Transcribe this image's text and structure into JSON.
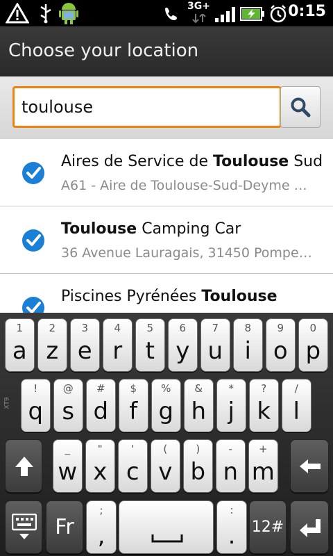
{
  "status_bar": {
    "network": "3G+",
    "time": "0:15",
    "icons": [
      "warning-icon",
      "usb-icon",
      "android-icon",
      "phone-mute-icon",
      "network-3g-icon",
      "signal-icon",
      "battery-charging-icon",
      "alarm-icon"
    ]
  },
  "title": "Choose your location",
  "search": {
    "value": "toulouse",
    "button_icon": "search-icon"
  },
  "results": [
    {
      "name_pre": "Aires de Service de ",
      "name_bold": "Toulouse",
      "name_post": " Sud",
      "address": "A61 - Aire de Toulouse-Sud-Deyme S..."
    },
    {
      "name_pre": "",
      "name_bold": "Toulouse",
      "name_post": " Camping Car",
      "address": "36 Avenue Lauragais, 31450 Pomper..."
    },
    {
      "name_pre": "Piscines Pyrénées ",
      "name_bold": "Toulouse",
      "name_post": "",
      "address": ""
    }
  ],
  "keyboard": {
    "row1": [
      {
        "hint": "1",
        "main": "a"
      },
      {
        "hint": "2",
        "main": "z"
      },
      {
        "hint": "3",
        "main": "e"
      },
      {
        "hint": "4",
        "main": "r"
      },
      {
        "hint": "5",
        "main": "t"
      },
      {
        "hint": "6",
        "main": "y"
      },
      {
        "hint": "7",
        "main": "u"
      },
      {
        "hint": "8",
        "main": "i"
      },
      {
        "hint": "9",
        "main": "o"
      },
      {
        "hint": "0",
        "main": "p"
      }
    ],
    "row2": [
      {
        "hint": "!",
        "main": "q"
      },
      {
        "hint": "@",
        "main": "s"
      },
      {
        "hint": "#",
        "main": "d"
      },
      {
        "hint": "$",
        "main": "f"
      },
      {
        "hint": "%",
        "main": "g"
      },
      {
        "hint": "&",
        "main": "h"
      },
      {
        "hint": "*",
        "main": "j"
      },
      {
        "hint": "?",
        "main": "k"
      },
      {
        "hint": "/",
        "main": "l"
      }
    ],
    "row3": [
      {
        "hint": "_",
        "main": "w"
      },
      {
        "hint": "\"",
        "main": "x"
      },
      {
        "hint": "'",
        "main": "c"
      },
      {
        "hint": "(",
        "main": "v"
      },
      {
        "hint": ")",
        "main": "b"
      },
      {
        "hint": "-",
        "main": "n"
      },
      {
        "hint": "+",
        "main": "m"
      }
    ],
    "lang_label": "Fr",
    "semicolon_hint": ";",
    "comma_label": ",",
    "colon_hint": ":",
    "period_label": ".",
    "num_label": "12#",
    "side_label": "XT9"
  }
}
